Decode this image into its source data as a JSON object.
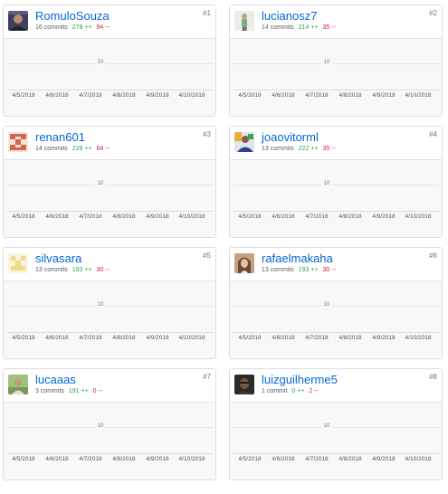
{
  "contributors": [
    {
      "rank": "#1",
      "username": "RomuloSouza",
      "commits": "16 commits",
      "additions": "278 ++",
      "deletions": "94 --",
      "avatar": "photo-dark"
    },
    {
      "rank": "#2",
      "username": "lucianosz7",
      "commits": "14 commits",
      "additions": "214 ++",
      "deletions": "35 --",
      "avatar": "photo-figure"
    },
    {
      "rank": "#3",
      "username": "renan601",
      "commits": "14 commits",
      "additions": "228 ++",
      "deletions": "64 --",
      "avatar": "identicon-red"
    },
    {
      "rank": "#4",
      "username": "joaovitorml",
      "commits": "13 commits",
      "additions": "222 ++",
      "deletions": "35 --",
      "avatar": "photo-colorful"
    },
    {
      "rank": "#5",
      "username": "silvasara",
      "commits": "13 commits",
      "additions": "193 ++",
      "deletions": "30 --",
      "avatar": "identicon-yellow"
    },
    {
      "rank": "#6",
      "username": "rafaelmakaha",
      "commits": "13 commits",
      "additions": "193 ++",
      "deletions": "30 --",
      "avatar": "photo-portrait"
    },
    {
      "rank": "#7",
      "username": "lucaaas",
      "commits": "3 commits",
      "additions": "191 ++",
      "deletions": "0 --",
      "avatar": "photo-outdoor"
    },
    {
      "rank": "#8",
      "username": "luizguilherme5",
      "commits": "1 commit",
      "additions": "0 ++",
      "deletions": "2 --",
      "avatar": "photo-dark-face"
    }
  ],
  "chart": {
    "y_tick": "10",
    "x_ticks": [
      "4/5/2018",
      "4/6/2018",
      "4/7/2018",
      "4/8/2018",
      "4/9/2018",
      "4/10/2018"
    ]
  },
  "colors": {
    "link": "#0366d6",
    "additions": "#28a745",
    "deletions": "#cb2431",
    "chart_bg": "#f8f8f8",
    "border": "#dddddd"
  }
}
